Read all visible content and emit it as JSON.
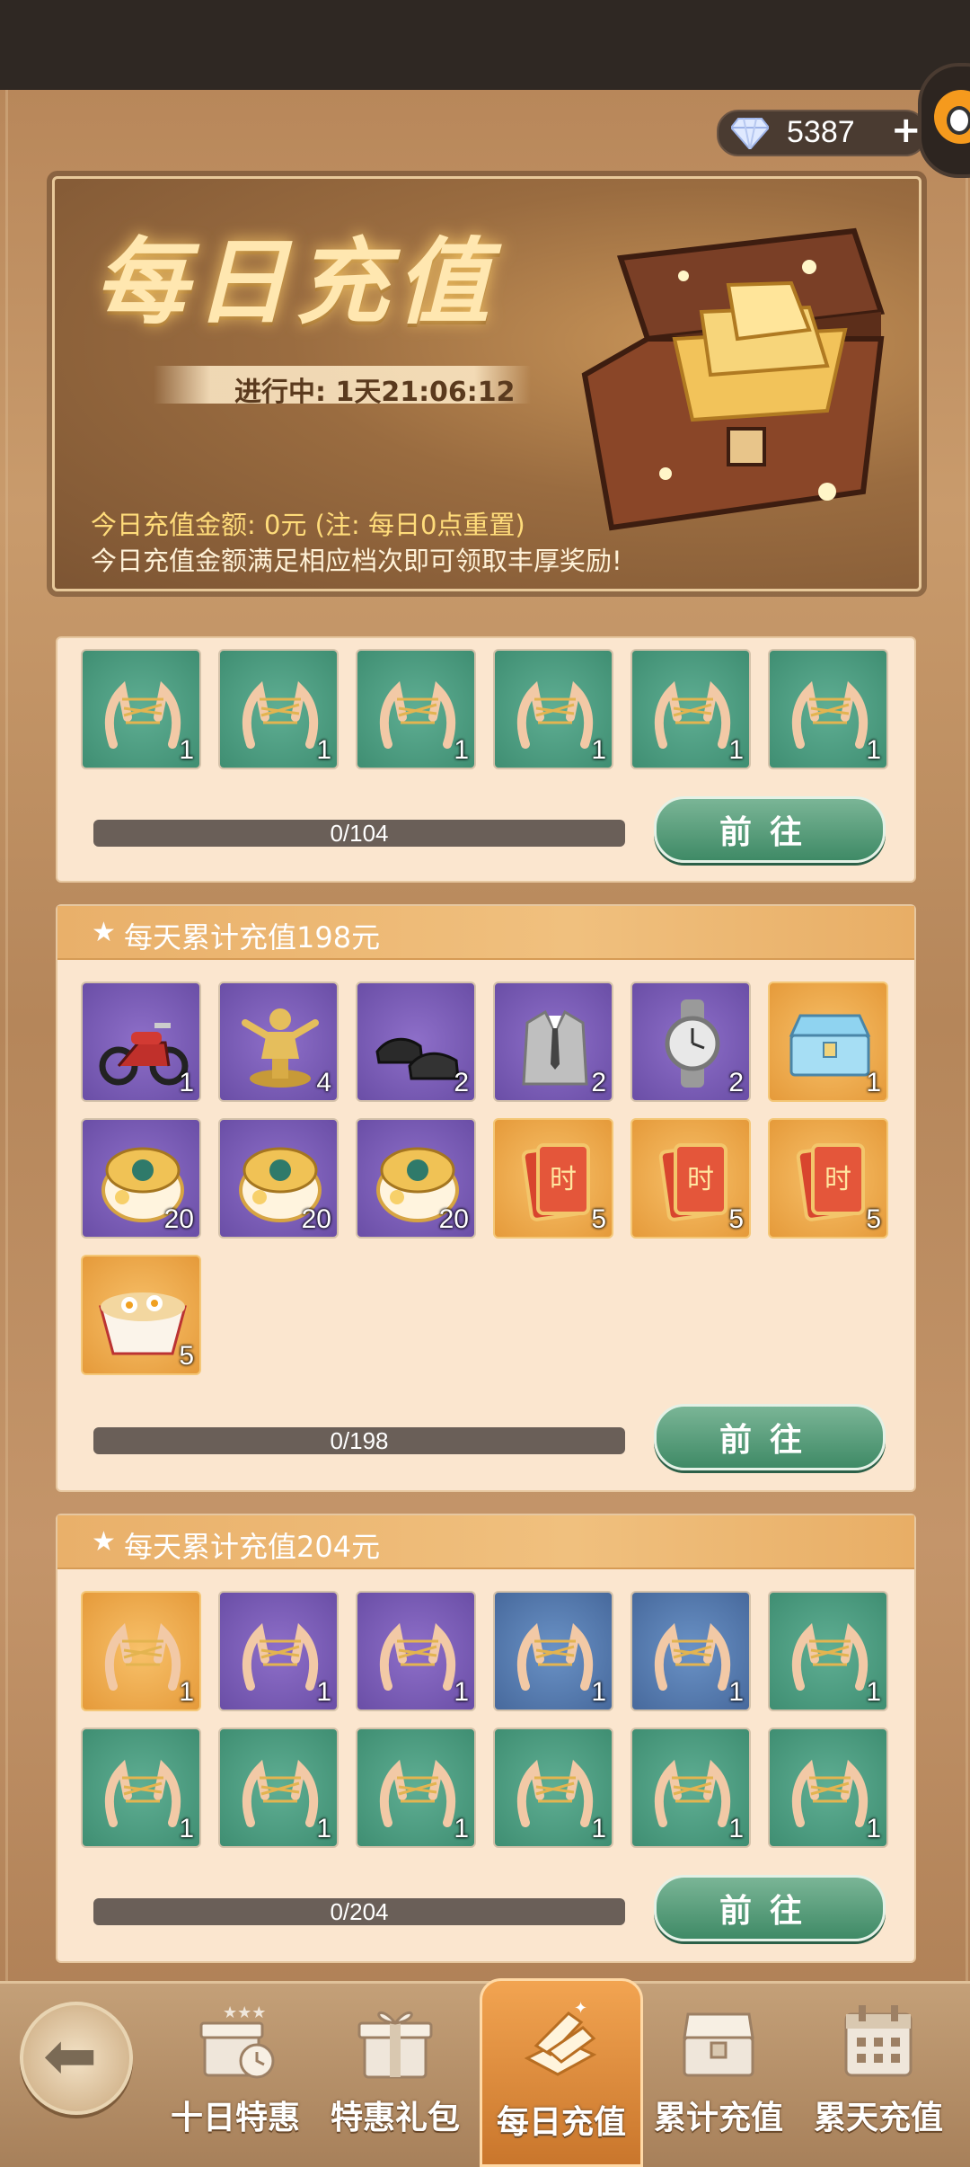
{
  "currency": {
    "value": "5387",
    "plus": "+"
  },
  "banner": {
    "title": "每日充值",
    "timer": "进行中: 1天21:06:12",
    "note1": "今日充值金额: 0元 (注: 每日0点重置)",
    "note2": "今日充值金额满足相应档次即可领取丰厚奖励!"
  },
  "tiers": [
    {
      "title": "",
      "progress": "0/104",
      "button": "前往",
      "items": [
        {
          "kind": "string",
          "color": "green",
          "qty": "1"
        },
        {
          "kind": "string",
          "color": "green",
          "qty": "1"
        },
        {
          "kind": "string",
          "color": "green",
          "qty": "1"
        },
        {
          "kind": "string",
          "color": "green",
          "qty": "1"
        },
        {
          "kind": "string",
          "color": "green",
          "qty": "1"
        },
        {
          "kind": "string",
          "color": "green",
          "qty": "1"
        }
      ]
    },
    {
      "title": "每天累计充值198元",
      "progress": "0/198",
      "button": "前往",
      "items": [
        {
          "kind": "motorcycle",
          "color": "purple",
          "qty": "1"
        },
        {
          "kind": "trophy",
          "color": "purple",
          "qty": "4"
        },
        {
          "kind": "shoes",
          "color": "purple",
          "qty": "2"
        },
        {
          "kind": "suit",
          "color": "purple",
          "qty": "2"
        },
        {
          "kind": "watch",
          "color": "purple",
          "qty": "2"
        },
        {
          "kind": "chest",
          "color": "gold",
          "qty": "1"
        },
        {
          "kind": "cream",
          "color": "purple",
          "qty": "20"
        },
        {
          "kind": "cream",
          "color": "purple",
          "qty": "20"
        },
        {
          "kind": "cream",
          "color": "purple",
          "qty": "20"
        },
        {
          "kind": "card",
          "color": "gold",
          "qty": "5"
        },
        {
          "kind": "card",
          "color": "gold",
          "qty": "5"
        },
        {
          "kind": "card",
          "color": "gold",
          "qty": "5"
        },
        {
          "kind": "noodles",
          "color": "gold",
          "qty": "5"
        }
      ]
    },
    {
      "title": "每天累计充值204元",
      "progress": "0/204",
      "button": "前往",
      "items": [
        {
          "kind": "string",
          "color": "gold",
          "qty": "1"
        },
        {
          "kind": "string",
          "color": "purple",
          "qty": "1"
        },
        {
          "kind": "string",
          "color": "purple",
          "qty": "1"
        },
        {
          "kind": "string",
          "color": "blue",
          "qty": "1"
        },
        {
          "kind": "string",
          "color": "blue",
          "qty": "1"
        },
        {
          "kind": "string",
          "color": "green",
          "qty": "1"
        },
        {
          "kind": "string",
          "color": "green",
          "qty": "1"
        },
        {
          "kind": "string",
          "color": "green",
          "qty": "1"
        },
        {
          "kind": "string",
          "color": "green",
          "qty": "1"
        },
        {
          "kind": "string",
          "color": "green",
          "qty": "1"
        },
        {
          "kind": "string",
          "color": "green",
          "qty": "1"
        },
        {
          "kind": "string",
          "color": "green",
          "qty": "1"
        }
      ]
    }
  ],
  "nav": {
    "tabs": [
      "十日特惠",
      "特惠礼包",
      "每日充值",
      "累计充值",
      "累天充值"
    ],
    "active": "每日充值"
  }
}
